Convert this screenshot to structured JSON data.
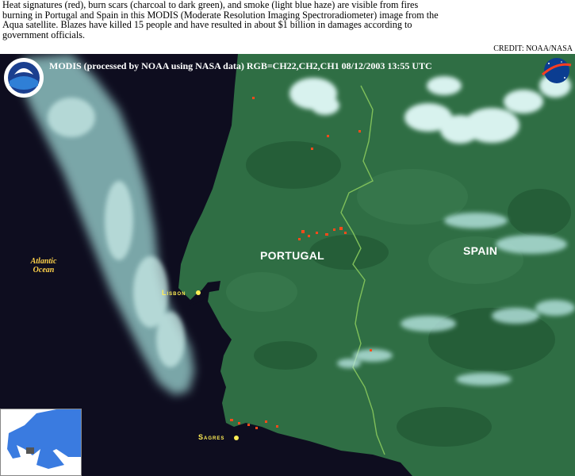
{
  "caption": "Heat signatures (red), burn scars (charcoal to dark green), and smoke (light blue haze) are visible from fires burning in Portugal and Spain in this MODIS (Moderate Resolution Imaging Spectroradiometer) image from the Aqua satellite.  Blazes have killed 15 people and have resulted in about $1 billion in damages according to government officials.",
  "credit": "CREDIT: NOAA/NASA",
  "image_header": "MODIS (processed by NOAA using NASA data)  RGB=CH22,CH2,CH1  08/12/2003  13:55 UTC",
  "labels": {
    "ocean": "Atlantic Ocean",
    "portugal": "PORTUGAL",
    "spain": "SPAIN",
    "lisbon": "Lisbon",
    "sagres": "Sagres"
  },
  "logos": {
    "noaa": "NOAA",
    "nasa": "NASA"
  },
  "colors": {
    "ocean": "#0e0d1f",
    "land": "#2f6e44",
    "land_dark": "#235a36",
    "border": "#7fbf5a",
    "smoke": "#9fd8d6",
    "cloud": "#d8f2ee",
    "fire": "#ff4a1a",
    "city_label": "#ffee55",
    "ocean_label": "#ffd24a"
  },
  "icons": [
    "noaa-logo-icon",
    "nasa-logo-icon",
    "europe-locator-map"
  ]
}
